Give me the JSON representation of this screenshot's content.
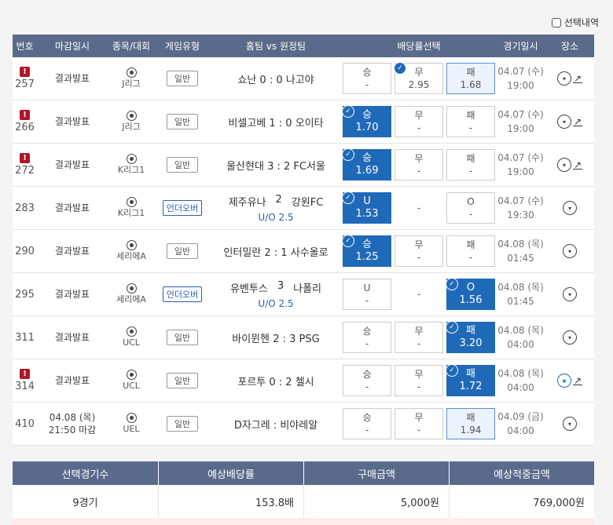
{
  "top": {
    "selection_label": "선택내역"
  },
  "headers": [
    "번호",
    "마감일시",
    "종목/대회",
    "게임유형",
    "홈팀 vs 원정팀",
    "배당률선택",
    "경기일시",
    "장소"
  ],
  "rows": [
    {
      "no": "257",
      "alert": true,
      "close": [
        "결과발표"
      ],
      "league": "J리그",
      "type": "일반",
      "type_kind": "normal",
      "match": "쇼난 0 : 0 나고야",
      "bets": [
        {
          "label": "승",
          "odd": "-",
          "state": "none"
        },
        {
          "label": "무",
          "odd": "2.95",
          "state": "hl-check"
        },
        {
          "label": "패",
          "odd": "1.68",
          "state": "hl"
        }
      ],
      "date": "04.07 (수)",
      "time": "19:00",
      "trend": true,
      "star": false
    },
    {
      "no": "266",
      "alert": true,
      "close": [
        "결과발표"
      ],
      "league": "J리그",
      "type": "일반",
      "type_kind": "normal",
      "match": "비셀고베 1 : 0 오이타",
      "bets": [
        {
          "label": "승",
          "odd": "1.70",
          "state": "sel"
        },
        {
          "label": "무",
          "odd": "-",
          "state": "none"
        },
        {
          "label": "패",
          "odd": "-",
          "state": "none"
        }
      ],
      "date": "04.07 (수)",
      "time": "19:00",
      "trend": true,
      "star": false
    },
    {
      "no": "272",
      "alert": true,
      "close": [
        "결과발표"
      ],
      "league": "K리그1",
      "type": "일반",
      "type_kind": "normal",
      "match": "울산현대 3 : 2 FC서울",
      "bets": [
        {
          "label": "승",
          "odd": "1.69",
          "state": "sel"
        },
        {
          "label": "무",
          "odd": "-",
          "state": "none"
        },
        {
          "label": "패",
          "odd": "-",
          "state": "none"
        }
      ],
      "date": "04.07 (수)",
      "time": "19:00",
      "trend": true,
      "star": false
    },
    {
      "no": "283",
      "alert": false,
      "close": [
        "결과발표"
      ],
      "league": "K리그1",
      "type": "언더오버",
      "type_kind": "uo",
      "home": "제주유나",
      "score": "2",
      "away": "강원FC",
      "uo": "U/O 2.5",
      "bets": [
        {
          "label": "U",
          "odd": "1.53",
          "state": "sel"
        },
        {
          "label": "",
          "odd": "-",
          "state": "plain"
        },
        {
          "label": "O",
          "odd": "-",
          "state": "none"
        }
      ],
      "date": "04.07 (수)",
      "time": "19:30",
      "trend": false,
      "star": false
    },
    {
      "no": "290",
      "alert": false,
      "close": [
        "결과발표"
      ],
      "league": "세리에A",
      "type": "일반",
      "type_kind": "normal",
      "match": "인터밀란 2 : 1 사수올로",
      "bets": [
        {
          "label": "승",
          "odd": "1.25",
          "state": "sel"
        },
        {
          "label": "무",
          "odd": "-",
          "state": "none"
        },
        {
          "label": "패",
          "odd": "-",
          "state": "none"
        }
      ],
      "date": "04.08 (목)",
      "time": "01:45",
      "trend": false,
      "star": false
    },
    {
      "no": "295",
      "alert": false,
      "close": [
        "결과발표"
      ],
      "league": "세리에A",
      "type": "언더오버",
      "type_kind": "uo",
      "home": "유벤투스",
      "score": "3",
      "away": "나폴리",
      "uo": "U/O 2.5",
      "bets": [
        {
          "label": "U",
          "odd": "-",
          "state": "none"
        },
        {
          "label": "",
          "odd": "-",
          "state": "plain"
        },
        {
          "label": "O",
          "odd": "1.56",
          "state": "sel"
        }
      ],
      "date": "04.08 (목)",
      "time": "01:45",
      "trend": false,
      "star": false
    },
    {
      "no": "311",
      "alert": false,
      "close": [
        "결과발표"
      ],
      "league": "UCL",
      "type": "일반",
      "type_kind": "normal",
      "match": "바이뮌헨 2 : 3 PSG",
      "bets": [
        {
          "label": "승",
          "odd": "-",
          "state": "none"
        },
        {
          "label": "무",
          "odd": "-",
          "state": "none"
        },
        {
          "label": "패",
          "odd": "3.20",
          "state": "sel"
        }
      ],
      "date": "04.08 (목)",
      "time": "04:00",
      "trend": false,
      "star": false
    },
    {
      "no": "314",
      "alert": true,
      "close": [
        "결과발표"
      ],
      "league": "UCL",
      "type": "일반",
      "type_kind": "normal",
      "match": "포르투 0 : 2 첼시",
      "bets": [
        {
          "label": "승",
          "odd": "-",
          "state": "none"
        },
        {
          "label": "무",
          "odd": "-",
          "state": "none"
        },
        {
          "label": "패",
          "odd": "1.72",
          "state": "sel"
        }
      ],
      "date": "04.08 (목)",
      "time": "04:00",
      "trend": true,
      "star": true
    },
    {
      "no": "410",
      "alert": false,
      "close": [
        "04.08 (목)",
        "21:50 마감"
      ],
      "league": "UEL",
      "type": "일반",
      "type_kind": "normal",
      "match": "D자그레 : 비야레알",
      "bets": [
        {
          "label": "승",
          "odd": "-",
          "state": "none"
        },
        {
          "label": "무",
          "odd": "-",
          "state": "none"
        },
        {
          "label": "패",
          "odd": "1.94",
          "state": "hl"
        }
      ],
      "date": "04.09 (금)",
      "time": "04:00",
      "trend": false,
      "star": false
    }
  ],
  "summary": {
    "headers": [
      "선택경기수",
      "예상배당률",
      "구매금액",
      "예상적중금액"
    ],
    "values": [
      "9경기",
      "153.8배",
      "5,000원",
      "769,000원"
    ]
  },
  "colors": {
    "header_bg": "#5a6a8a",
    "selected": "#1f6ab8",
    "alert": "#b0152a"
  }
}
